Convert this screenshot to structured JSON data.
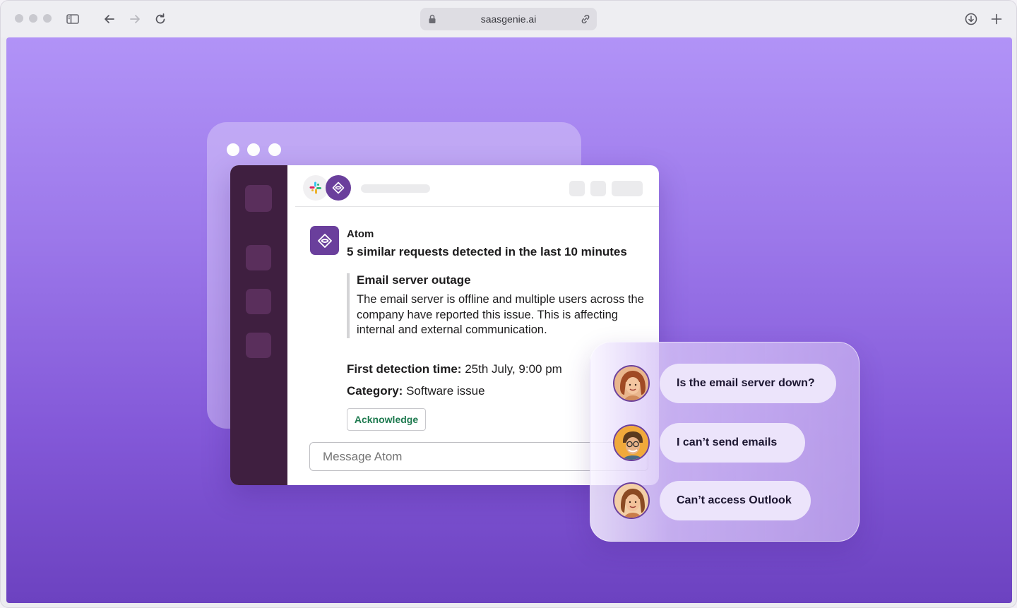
{
  "browser": {
    "url": "saasgenie.ai"
  },
  "slack": {
    "sender": "Atom",
    "headline": "5 similar requests detected in the last 10 minutes",
    "alert_title": "Email server outage",
    "alert_body": "The email server is offline and multiple users across the company have reported this issue. This is affecting internal and external communication.",
    "detection_label": "First detection time:",
    "detection_value": " 25th July, 9:00 pm",
    "category_label": "Category:",
    "category_value": " Software issue",
    "acknowledge_label": "Acknowledge",
    "input_placeholder": "Message Atom"
  },
  "complaints": [
    {
      "text": "Is the email server down?"
    },
    {
      "text": "I can’t send emails"
    },
    {
      "text": "Can’t access Outlook"
    }
  ],
  "colors": {
    "brand_purple": "#6a3f9c",
    "slack_sidebar": "#3f1f40",
    "acknowledge_green": "#1e7a4f"
  }
}
